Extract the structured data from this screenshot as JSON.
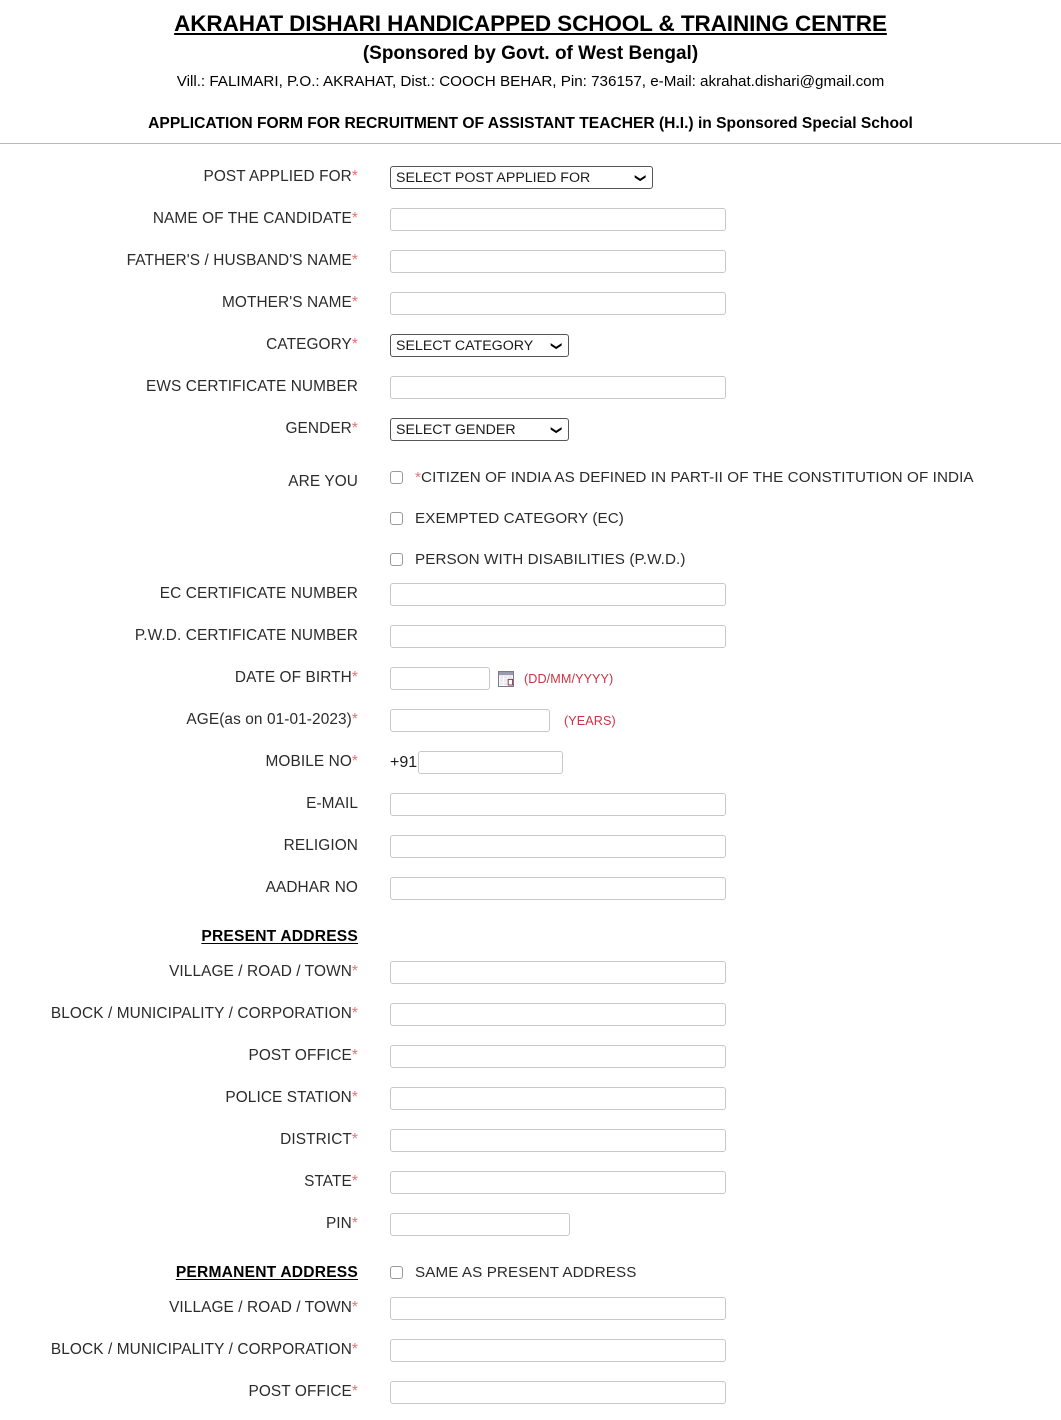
{
  "header": {
    "org_name": "AKRAHAT DISHARI HANDICAPPED SCHOOL & TRAINING CENTRE",
    "sponsor": "(Sponsored by Govt. of West Bengal)",
    "address": "Vill.: FALIMARI, P.O.: AKRAHAT, Dist.: COOCH BEHAR, Pin: 736157, e-Mail: akrahat.dishari@gmail.com",
    "form_title": "APPLICATION FORM FOR RECRUITMENT OF ASSISTANT TEACHER (H.I.) in Sponsored Special School"
  },
  "colors": {
    "required_asterisk": "#e8737a",
    "hint_red": "#cc3344",
    "label_text": "#2b2b2b",
    "rule": "#b9b9b9",
    "input_border": "#c8c8c8",
    "select_border": "#555555"
  },
  "labels": {
    "post_applied_for": "POST APPLIED FOR",
    "name_of_candidate": "NAME OF THE CANDIDATE",
    "fathers_husbands_name": "FATHER'S / HUSBAND'S NAME",
    "mothers_name": "MOTHER'S NAME",
    "category": "CATEGORY",
    "ews_certificate_number": "EWS CERTIFICATE NUMBER",
    "gender": "GENDER",
    "are_you": "ARE YOU",
    "ec_certificate_number": "EC CERTIFICATE NUMBER",
    "pwd_certificate_number": "P.W.D. CERTIFICATE NUMBER",
    "date_of_birth": "DATE OF BIRTH",
    "age": "AGE(as on 01-01-2023)",
    "mobile_no": "MOBILE NO",
    "email": "E-MAIL",
    "religion": "RELIGION",
    "aadhar_no": "AADHAR NO",
    "village_road_town": "VILLAGE / ROAD / TOWN",
    "block_municipality_corporation": "BLOCK / MUNICIPALITY / CORPORATION",
    "post_office": "POST OFFICE",
    "police_station": "POLICE STATION",
    "district": "DISTRICT",
    "state": "STATE",
    "pin": "PIN"
  },
  "required_marker": "*",
  "selects": {
    "post_applied_for": {
      "selected": "SELECT POST APPLIED FOR",
      "options": [
        "SELECT POST APPLIED FOR"
      ]
    },
    "category": {
      "selected": "SELECT CATEGORY",
      "options": [
        "SELECT CATEGORY"
      ]
    },
    "gender": {
      "selected": "SELECT GENDER",
      "options": [
        "SELECT GENDER"
      ]
    }
  },
  "values": {
    "name_of_candidate": "",
    "fathers_husbands_name": "",
    "mothers_name": "",
    "ews_certificate_number": "",
    "ec_certificate_number": "",
    "pwd_certificate_number": "",
    "date_of_birth": "",
    "age": "",
    "mobile_no": "",
    "email": "",
    "religion": "",
    "aadhar_no": "",
    "present_village_road_town": "",
    "present_block_municipality_corporation": "",
    "present_post_office": "",
    "present_police_station": "",
    "present_district": "",
    "present_state": "",
    "present_pin": "",
    "permanent_village_road_town": "",
    "permanent_block_municipality_corporation": "",
    "permanent_post_office": ""
  },
  "are_you_options": [
    {
      "label": "CITIZEN OF INDIA AS DEFINED IN PART-II OF THE CONSTITUTION OF INDIA",
      "required": true,
      "checked": false
    },
    {
      "label": "EXEMPTED CATEGORY (EC)",
      "required": false,
      "checked": false
    },
    {
      "label": "PERSON WITH DISABILITIES (P.W.D.)",
      "required": false,
      "checked": false
    }
  ],
  "hints": {
    "date_format": "(DD/MM/YYYY)",
    "age_unit": "(YEARS)",
    "mobile_prefix": "+91"
  },
  "sections": {
    "present_address": "PRESENT ADDRESS",
    "permanent_address": "PERMANENT ADDRESS",
    "same_as_present_address": "SAME AS PRESENT ADDRESS"
  },
  "icons": {
    "calendar": "calendar-icon",
    "chevron_down": "chevron-down-icon"
  }
}
